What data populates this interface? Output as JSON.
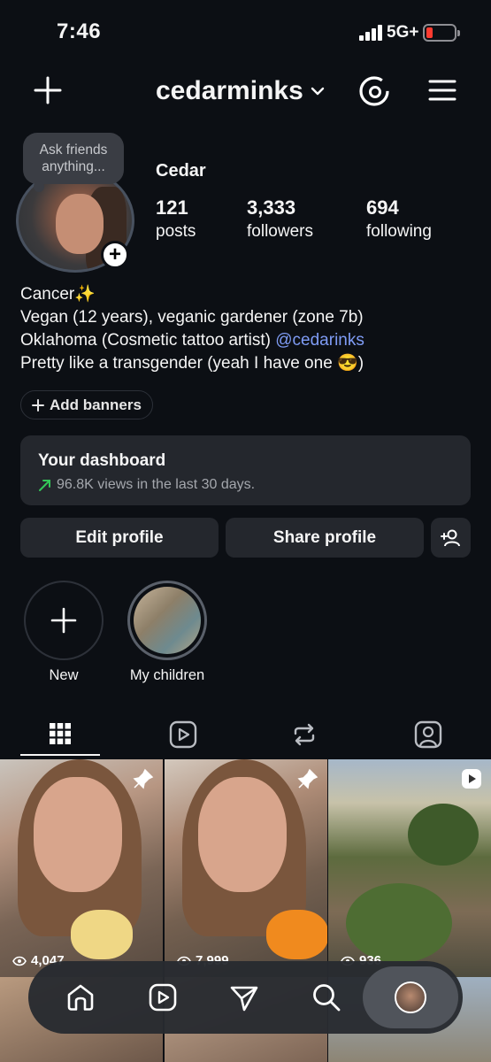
{
  "status_bar": {
    "time": "7:46",
    "network": "5G+"
  },
  "header": {
    "username": "cedarminks"
  },
  "note": {
    "text_line1": "Ask friends",
    "text_line2": "anything..."
  },
  "profile": {
    "display_name": "Cedar",
    "stats": [
      {
        "value": "121",
        "label": "posts"
      },
      {
        "value": "3,333",
        "label": "followers"
      },
      {
        "value": "694",
        "label": "following"
      }
    ],
    "bio": {
      "line1": "Cancer✨",
      "line2": "Vegan (12 years), veganic gardener (zone 7b)",
      "line3_text": "Oklahoma (Cosmetic tattoo artist) ",
      "line3_link": "@cedarinks",
      "line4": "Pretty like a transgender (yeah I have one 😎)"
    },
    "add_banners": "Add banners"
  },
  "dashboard": {
    "title": "Your dashboard",
    "subtitle": "96.8K views in the last 30 days."
  },
  "actions": {
    "edit": "Edit profile",
    "share": "Share profile"
  },
  "highlights": [
    {
      "label": "New"
    },
    {
      "label": "My children"
    }
  ],
  "posts": [
    {
      "views": "4,047",
      "pinned": true,
      "type": "photo"
    },
    {
      "views": "7,999",
      "pinned": true,
      "type": "photo"
    },
    {
      "views": "936",
      "pinned": false,
      "type": "reel"
    }
  ],
  "colors": {
    "background": "#0c0f14",
    "card": "#24272d",
    "link": "#7f9cf5",
    "trend_up": "#34c759",
    "battery_low": "#ff3b30"
  },
  "icons": [
    "plus-icon",
    "chevron-down-icon",
    "threads-icon",
    "hamburger-menu-icon",
    "grid-icon",
    "reels-icon",
    "repost-icon",
    "tagged-icon",
    "home-icon",
    "send-icon",
    "search-icon",
    "pin-icon",
    "reel-badge-icon",
    "eye-icon",
    "add-person-icon",
    "trend-up-icon"
  ]
}
